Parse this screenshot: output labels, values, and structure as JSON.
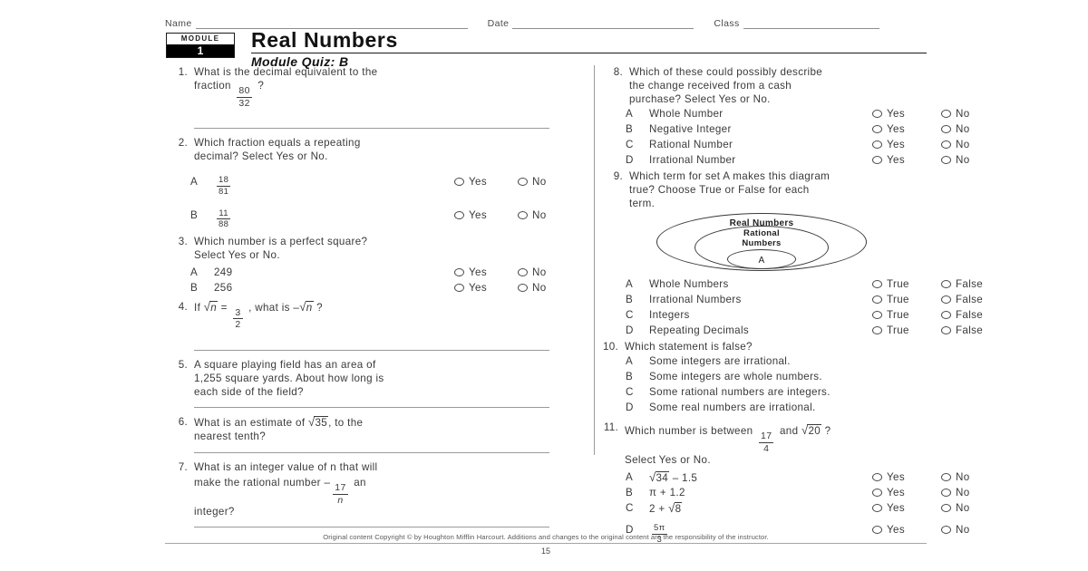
{
  "header": {
    "name_label": "Name",
    "date_label": "Date",
    "class_label": "Class",
    "module_word": "MODULE",
    "module_number": "1",
    "title": "Real Numbers",
    "subtitle": "Module Quiz: B"
  },
  "questions": {
    "q1": {
      "number": "1.",
      "line1": "What is the decimal equivalent to the",
      "line2_pre": "fraction",
      "frac_num": "80",
      "frac_den": "32",
      "line2_post": "?"
    },
    "q2": {
      "number": "2.",
      "line1": "Which fraction equals a repeating",
      "line2": "decimal? Select Yes or No.",
      "options": [
        {
          "letter": "A",
          "num": "18",
          "den": "81",
          "yes": "Yes",
          "no": "No"
        },
        {
          "letter": "B",
          "num": "11",
          "den": "88",
          "yes": "Yes",
          "no": "No"
        }
      ]
    },
    "q3": {
      "number": "3.",
      "line1": "Which number is a perfect square?",
      "line2": "Select Yes or No.",
      "options": [
        {
          "letter": "A",
          "text": "249",
          "yes": "Yes",
          "no": "No"
        },
        {
          "letter": "B",
          "text": "256",
          "yes": "Yes",
          "no": "No"
        }
      ]
    },
    "q4": {
      "number": "4.",
      "pre": "If",
      "radicand": "n",
      "eq": "=",
      "frac_num": "3",
      "frac_den": "2",
      "mid": ", what is",
      "minus": "–",
      "radicand2": "n",
      "post": "?"
    },
    "q5": {
      "number": "5.",
      "line1": "A square playing field has an area of",
      "line2": "1,255 square yards. About how long is",
      "line3": "each side of the field?"
    },
    "q6": {
      "number": "6.",
      "line1_pre": "What is an estimate of",
      "radicand": "35",
      "line1_post": ", to the",
      "line2": "nearest tenth?"
    },
    "q7": {
      "number": "7.",
      "line1": "What is an integer value of n that will",
      "line2_pre": "make the rational number",
      "minus": "–",
      "frac_num": "17",
      "frac_den": "n",
      "line2_post": "an",
      "line3": "integer?"
    },
    "q8": {
      "number": "8.",
      "line1": "Which of these could possibly describe",
      "line2": "the change received from a cash",
      "line3": "purchase? Select Yes or No.",
      "options": [
        {
          "letter": "A",
          "text": "Whole Number",
          "yes": "Yes",
          "no": "No"
        },
        {
          "letter": "B",
          "text": "Negative Integer",
          "yes": "Yes",
          "no": "No"
        },
        {
          "letter": "C",
          "text": "Rational Number",
          "yes": "Yes",
          "no": "No"
        },
        {
          "letter": "D",
          "text": "Irrational Number",
          "yes": "Yes",
          "no": "No"
        }
      ]
    },
    "q9": {
      "number": "9.",
      "line1": "Which term for set A makes this diagram",
      "line2": "true? Choose True or False for each",
      "line3": "term.",
      "diagram": {
        "outer_label": "Real Numbers",
        "middle_label_line1": "Rational",
        "middle_label_line2": "Numbers",
        "inner_label": "A"
      },
      "options": [
        {
          "letter": "A",
          "text": "Whole Numbers",
          "true": "True",
          "false": "False"
        },
        {
          "letter": "B",
          "text": "Irrational Numbers",
          "true": "True",
          "false": "False"
        },
        {
          "letter": "C",
          "text": "Integers",
          "true": "True",
          "false": "False"
        },
        {
          "letter": "D",
          "text": "Repeating Decimals",
          "true": "True",
          "false": "False"
        }
      ]
    },
    "q10": {
      "number": "10.",
      "line1": "Which statement is false?",
      "options": [
        {
          "letter": "A",
          "text": "Some integers are irrational."
        },
        {
          "letter": "B",
          "text": "Some integers are whole numbers."
        },
        {
          "letter": "C",
          "text": "Some rational numbers are integers."
        },
        {
          "letter": "D",
          "text": "Some real numbers are irrational."
        }
      ]
    },
    "q11": {
      "number": "11.",
      "line1_pre": "Which number is between",
      "frac_num": "17",
      "frac_den": "4",
      "line1_mid": "and",
      "radicand": "20",
      "line1_post": "?",
      "line2": "Select Yes or No.",
      "options": [
        {
          "letter": "A",
          "kind": "radical",
          "radicand": "34",
          "tail": "– 1.5",
          "yes": "Yes",
          "no": "No"
        },
        {
          "letter": "B",
          "kind": "plain",
          "text": "π + 1.2",
          "yes": "Yes",
          "no": "No"
        },
        {
          "letter": "C",
          "kind": "radical-lead",
          "lead": "2 +",
          "radicand": "8",
          "yes": "Yes",
          "no": "No"
        },
        {
          "letter": "D",
          "kind": "fraction",
          "num": "5π",
          "den": "3",
          "yes": "Yes",
          "no": "No"
        }
      ]
    }
  },
  "footer": {
    "copyright": "Original content Copyright © by Houghton Mifflin Harcourt. Additions and changes to the original content are the responsibility of the instructor.",
    "page_number": "15"
  }
}
